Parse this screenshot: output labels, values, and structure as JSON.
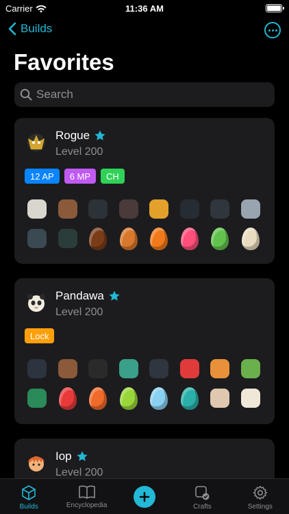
{
  "status": {
    "carrier": "Carrier",
    "time": "11:36 AM"
  },
  "nav": {
    "back_label": "Builds"
  },
  "page_title": "Favorites",
  "search": {
    "placeholder": "Search"
  },
  "builds": [
    {
      "name": "Rogue",
      "level": "Level 200",
      "favorite": true,
      "tags": [
        {
          "label": "12 AP",
          "color": "#0a84ff"
        },
        {
          "label": "6 MP",
          "color": "#bf5af2"
        },
        {
          "label": "CH",
          "color": "#30d158"
        }
      ],
      "items": [
        {
          "icon": "skull-hat-icon",
          "color": "#d9d6cf"
        },
        {
          "icon": "fire-sword-icon",
          "color": "#8a5a3a"
        },
        {
          "icon": "dark-cape-icon",
          "color": "#2c3338"
        },
        {
          "icon": "dark-wing-icon",
          "color": "#4a3a3a"
        },
        {
          "icon": "bomb-amulet-icon",
          "color": "#e3a12b"
        },
        {
          "icon": "spiked-ring-icon",
          "color": "#262c33"
        },
        {
          "icon": "shadow-boots-icon",
          "color": "#30363d"
        },
        {
          "icon": "horned-shield-icon",
          "color": "#98a4b0"
        },
        {
          "icon": "spider-dofus-icon",
          "color": "#3b4a52"
        },
        {
          "icon": "spider-pet-icon",
          "color": "#2a3d3a"
        },
        {
          "icon": "amber-egg-icon",
          "color": "#7a3d18"
        },
        {
          "icon": "blue-gold-egg-icon",
          "color": "#d8782c"
        },
        {
          "icon": "fire-egg-icon",
          "color": "#f07a1a"
        },
        {
          "icon": "pink-egg-icon",
          "color": "#ff4f7a"
        },
        {
          "icon": "green-egg-icon",
          "color": "#62c24e"
        },
        {
          "icon": "ivory-egg-icon",
          "color": "#e8dcc0"
        }
      ]
    },
    {
      "name": "Pandawa",
      "level": "Level 200",
      "favorite": true,
      "tags": [
        {
          "label": "Lock",
          "color": "#ff9f0a"
        }
      ],
      "items": [
        {
          "icon": "witch-hat-icon",
          "color": "#2c3440"
        },
        {
          "icon": "fire-sword-icon",
          "color": "#8a5a3a"
        },
        {
          "icon": "gold-belt-icon",
          "color": "#2a2a2a"
        },
        {
          "icon": "green-dragon-icon",
          "color": "#3aa08a"
        },
        {
          "icon": "robot-amulet-icon",
          "color": "#2e3640"
        },
        {
          "icon": "red-crab-icon",
          "color": "#e03a3a"
        },
        {
          "icon": "gem-ring-icon",
          "color": "#e8903a"
        },
        {
          "icon": "green-pet-icon",
          "color": "#6ab04c"
        },
        {
          "icon": "green-feather-icon",
          "color": "#2a8a5a"
        },
        {
          "icon": "red-shield-egg-icon",
          "color": "#e83a3a"
        },
        {
          "icon": "orange-egg-icon",
          "color": "#f06a2a"
        },
        {
          "icon": "lime-egg-icon",
          "color": "#9ad63a"
        },
        {
          "icon": "ice-egg-icon",
          "color": "#8ad0f0"
        },
        {
          "icon": "teal-egg-icon",
          "color": "#2ab0a8"
        },
        {
          "icon": "scroll-icon",
          "color": "#e0c8b0"
        },
        {
          "icon": "white-mount-icon",
          "color": "#efe8d8"
        }
      ]
    },
    {
      "name": "Iop",
      "level": "Level 200",
      "favorite": true
    }
  ],
  "tabbar": [
    {
      "label": "Builds",
      "icon": "cube-icon",
      "active": true
    },
    {
      "label": "Encyclopedia",
      "icon": "book-icon",
      "active": false
    },
    {
      "label": "",
      "icon": "plus-icon",
      "active": false
    },
    {
      "label": "Crafts",
      "icon": "craft-check-icon",
      "active": false
    },
    {
      "label": "Settings",
      "icon": "gear-icon",
      "active": false
    }
  ],
  "colors": {
    "accent": "#22b8d6",
    "card": "#1c1c1e",
    "secondary_text": "#8e8e93"
  }
}
